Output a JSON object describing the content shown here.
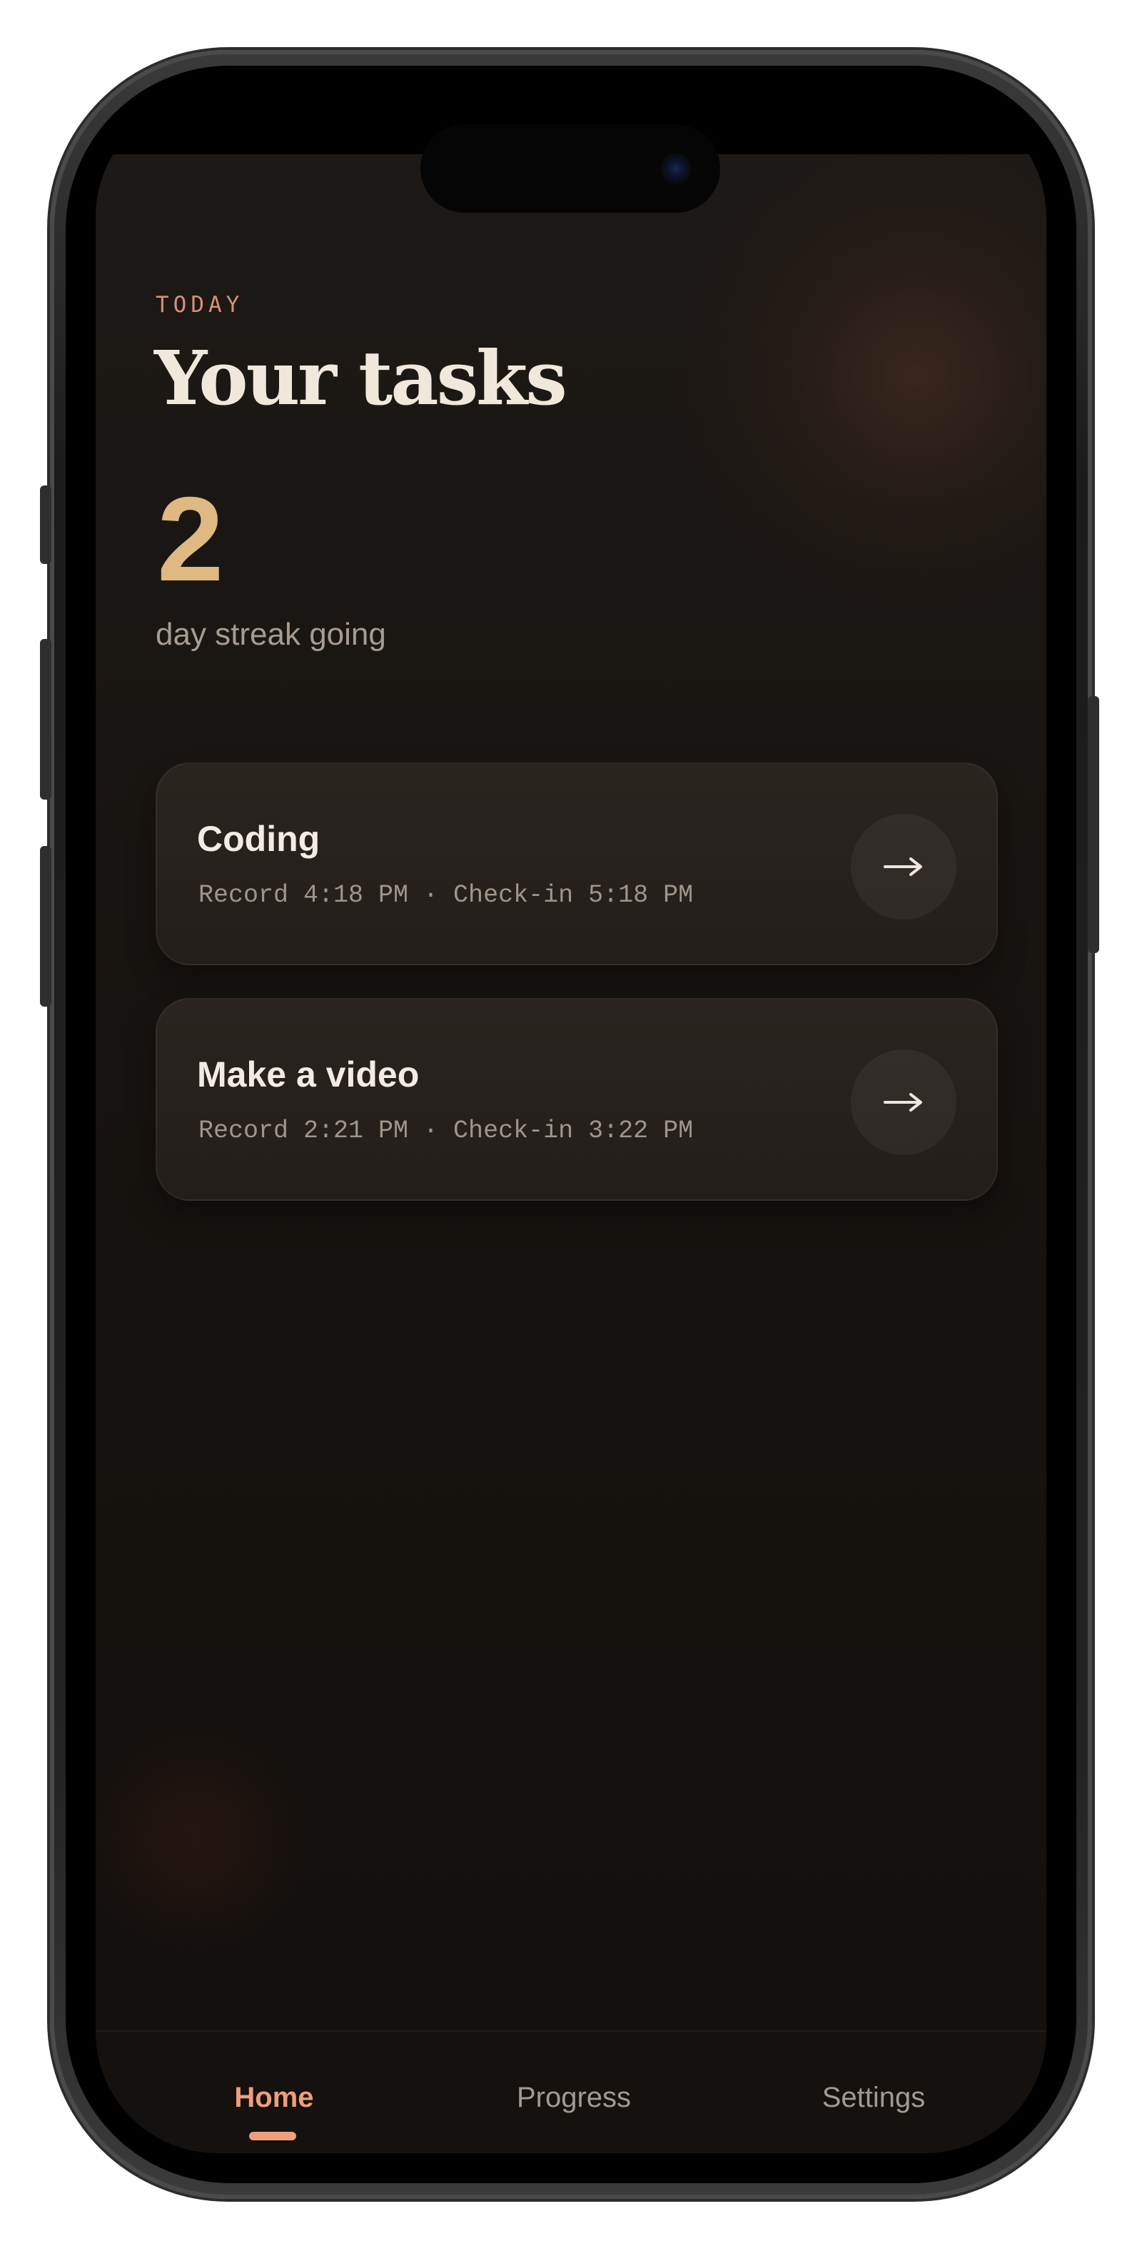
{
  "header": {
    "eyebrow": "TODAY",
    "title": "Your tasks"
  },
  "streak": {
    "count": "2",
    "label": "day streak going"
  },
  "tasks": [
    {
      "title": "Coding",
      "meta": "Record 4:18 PM · Check-in 5:18 PM",
      "action_icon": "arrow-right-icon"
    },
    {
      "title": "Make a video",
      "meta": "Record 2:21 PM · Check-in 3:22 PM",
      "action_icon": "arrow-right-icon"
    }
  ],
  "tabbar": {
    "items": [
      {
        "label": "Home",
        "active": true
      },
      {
        "label": "Progress",
        "active": false
      },
      {
        "label": "Settings",
        "active": false
      }
    ]
  },
  "colors": {
    "accent": "#f09d7c",
    "streak": "#dfb981",
    "background": "#171310",
    "card": "#2b2521"
  }
}
